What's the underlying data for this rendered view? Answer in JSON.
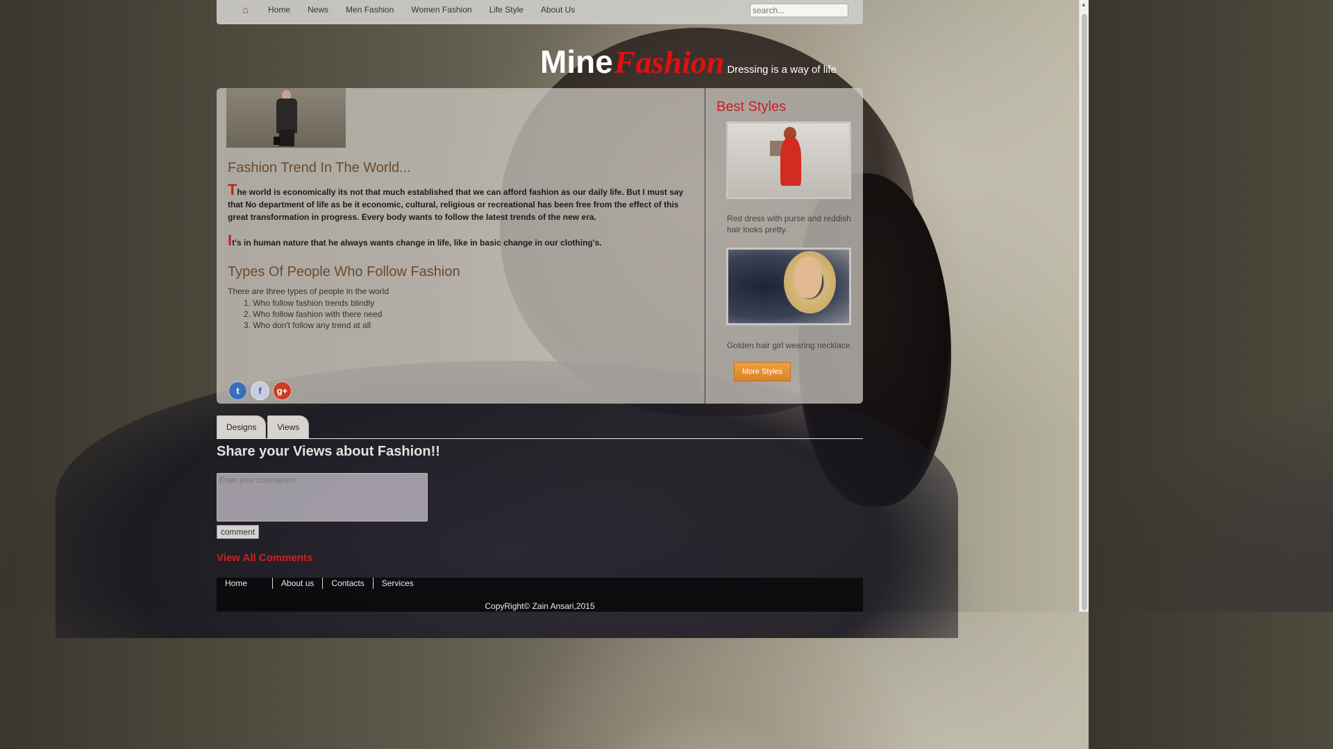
{
  "nav": {
    "home_icon": "home-icon",
    "items": [
      "Home",
      "News",
      "Men Fashion",
      "Women Fashion",
      "Life Style",
      "About Us"
    ],
    "search_placeholder": "search..."
  },
  "logo": {
    "mine": "Mine",
    "fashion": "Fashion",
    "tagline": "Dressing is a way of life"
  },
  "main": {
    "heading1": "Fashion Trend In The World...",
    "para1_dropcap": "T",
    "para1_text": "he world is economically its not that much established that we can afford fashion as our daily life. But I must say that No department of life as be it economic, cultural, religious or recreational has been free from the effect of this great transformation in progress. Every body wants to follow the latest trends of the new era.",
    "para2_dropcap": "I",
    "para2_text": "t's in human nature that he always wants change in life, like in basic change in our clothing's.",
    "heading2": "Types Of People Who Follow Fashion",
    "types_intro": "There are three types of people in the world",
    "types": [
      {
        "num": "1.",
        "text": "Who follow fashion trends blindly"
      },
      {
        "num": "2.",
        "text": "Who follow fashion with there need"
      },
      {
        "num": "3.",
        "text": "Who don't follow any trend at all"
      }
    ],
    "social": [
      "twitter-icon",
      "facebook-icon",
      "google-plus-icon"
    ],
    "social_glyphs": {
      "twitter": "t",
      "facebook": "f",
      "google": "g+"
    }
  },
  "side": {
    "title": "Best Styles",
    "caption1": "Red dress with purse and reddish hair looks pretty.",
    "caption2": "Golden hair girl wearing necklace.",
    "more_button": "More Styles"
  },
  "tabs": [
    "Designs",
    "Views"
  ],
  "comments": {
    "title": "Share your Views about Fashion!!",
    "placeholder": "Enter your comments!!",
    "button": "comment",
    "view_all": "View All Comments"
  },
  "footer": {
    "links": [
      "Home",
      "About us",
      "Contacts",
      "Services"
    ],
    "copyright": "CopyRight© Zain Ansari,2015"
  },
  "colors": {
    "accent_red": "#c8201e",
    "heading_brown": "#6a4a2e",
    "button_orange": "#d9822a"
  }
}
